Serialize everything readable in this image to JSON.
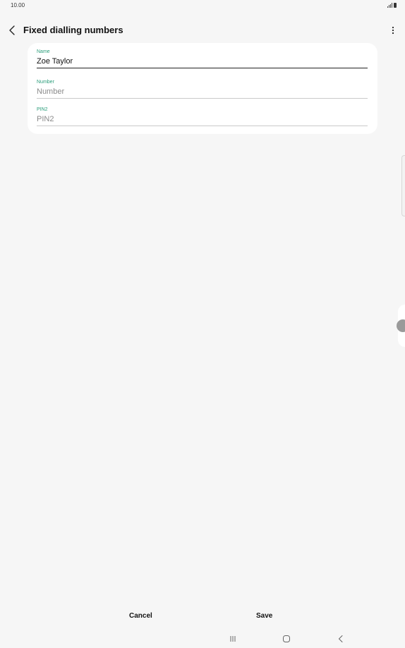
{
  "status_bar": {
    "time": "10.00"
  },
  "header": {
    "title": "Fixed dialling numbers",
    "back_icon": "chevron-left-icon",
    "menu_icon": "more-vertical-icon"
  },
  "form": {
    "name": {
      "label": "Name",
      "value": "Zoe Taylor",
      "placeholder": ""
    },
    "number": {
      "label": "Number",
      "value": "",
      "placeholder": "Number"
    },
    "pin2": {
      "label": "PIN2",
      "value": "",
      "placeholder": "PIN2"
    }
  },
  "actions": {
    "cancel_label": "Cancel",
    "save_label": "Save"
  },
  "colors": {
    "accent": "#2a9d7a",
    "background": "#f6f6f6",
    "card": "#ffffff"
  }
}
